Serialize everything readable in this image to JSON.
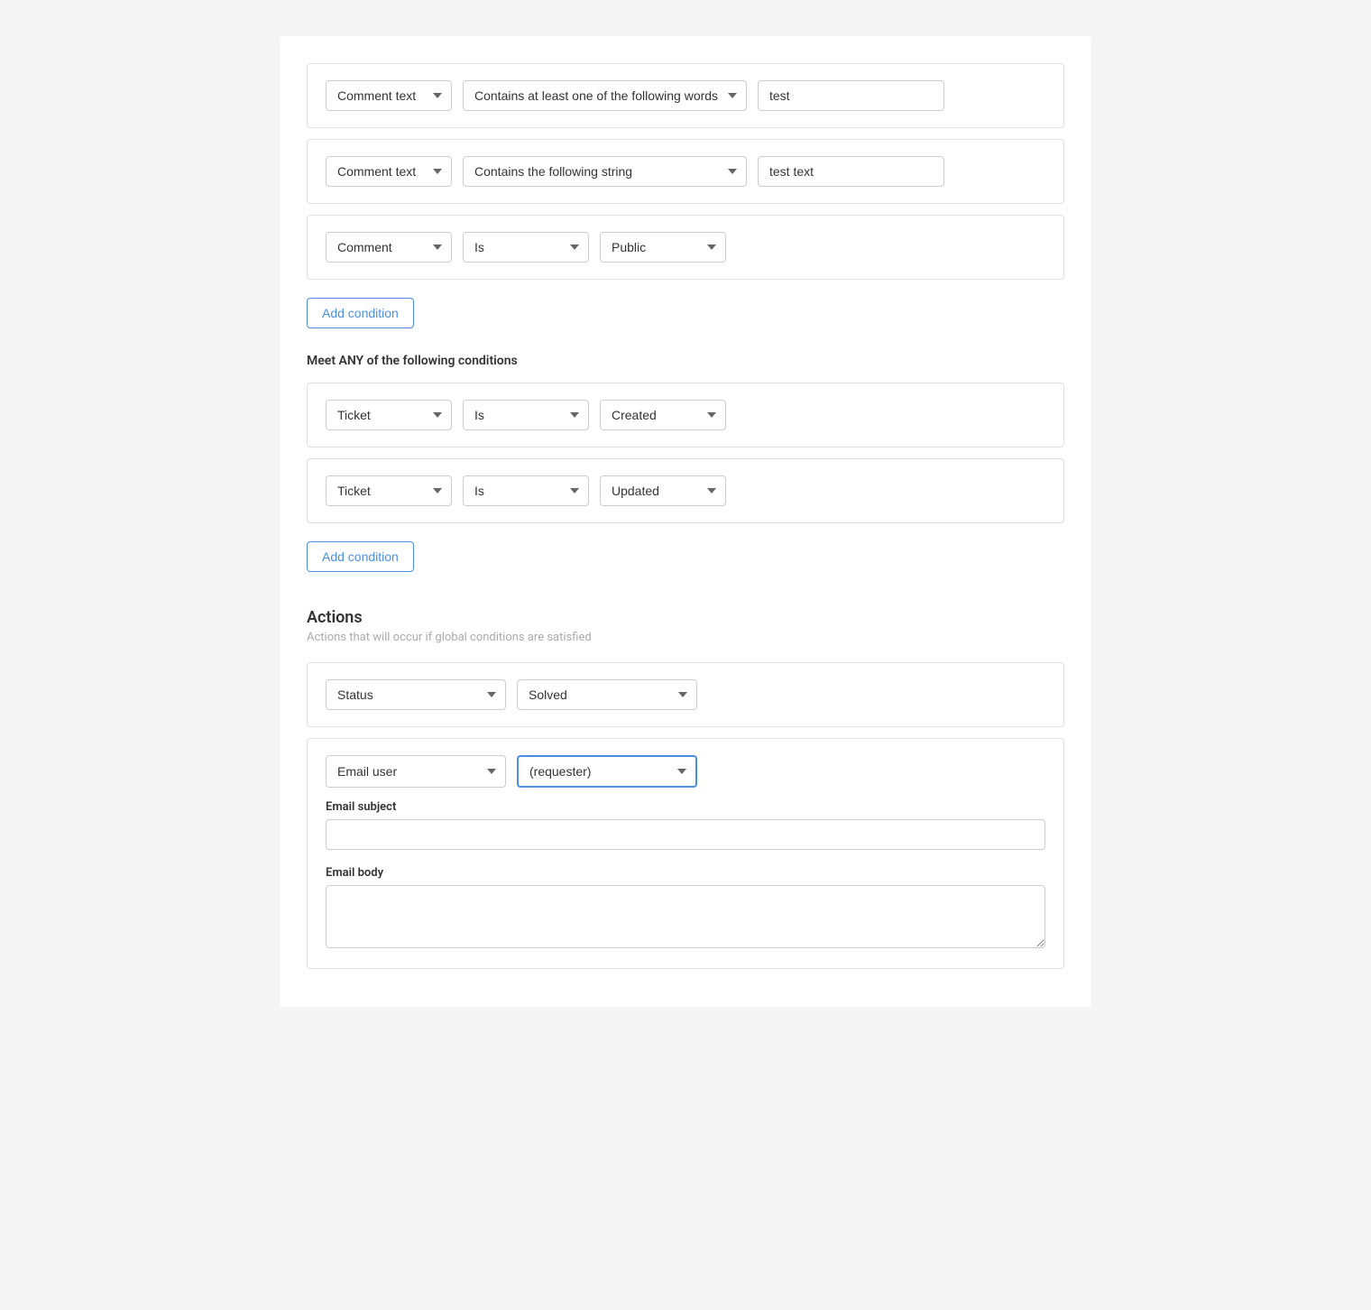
{
  "conditions": {
    "allConditions": [
      {
        "id": "cond1",
        "field": "Comment text",
        "operator": "Contains at least one of the following words",
        "value": "test",
        "valueType": "text"
      },
      {
        "id": "cond2",
        "field": "Comment text",
        "operator": "Contains the following string",
        "value": "test text",
        "valueType": "text"
      },
      {
        "id": "cond3",
        "field": "Comment",
        "operator": "Is",
        "value": "Public",
        "valueType": "select"
      }
    ],
    "addConditionLabel1": "Add condition",
    "anyConditionsTitle": "Meet ANY of the following conditions",
    "anyConditions": [
      {
        "id": "anycond1",
        "field": "Ticket",
        "operator": "Is",
        "value": "Created",
        "valueType": "select"
      },
      {
        "id": "anycond2",
        "field": "Ticket",
        "operator": "Is",
        "value": "Updated",
        "valueType": "select"
      }
    ],
    "addConditionLabel2": "Add condition"
  },
  "actions": {
    "title": "Actions",
    "subtitle": "Actions that will occur if global conditions are satisfied",
    "rows": [
      {
        "id": "action1",
        "field": "Status",
        "value": "Solved",
        "highlighted": false
      },
      {
        "id": "action2",
        "field": "Email user",
        "value": "(requester)",
        "highlighted": true
      }
    ],
    "emailSubject": {
      "label": "Email subject",
      "value": "",
      "placeholder": ""
    },
    "emailBody": {
      "label": "Email body",
      "value": "",
      "placeholder": ""
    }
  },
  "fieldOptions": {
    "commentText": "Comment text",
    "comment": "Comment",
    "ticket": "Ticket",
    "status": "Status",
    "emailUser": "Email user"
  },
  "operatorOptions": {
    "containsAtLeastOneWord": "Contains at least one of the following words",
    "containsString": "Contains the following string",
    "is": "Is"
  },
  "valueOptions": {
    "public": "Public",
    "created": "Created",
    "updated": "Updated",
    "solved": "Solved",
    "requester": "(requester)"
  }
}
